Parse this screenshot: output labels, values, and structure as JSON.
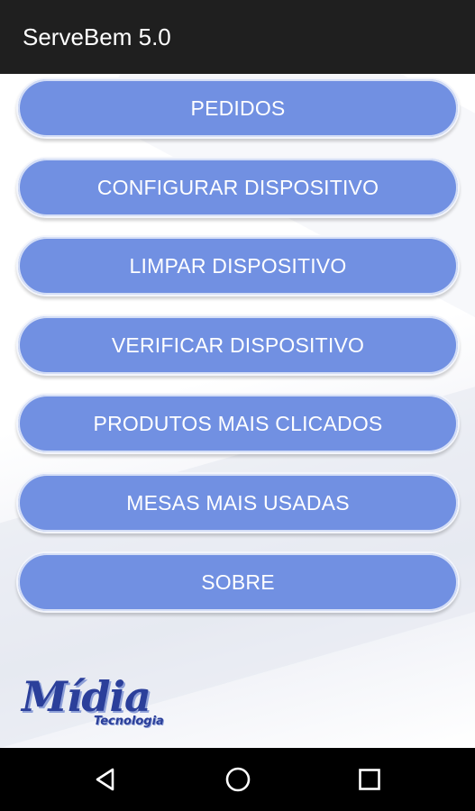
{
  "app_bar": {
    "title": "ServeBem 5.0"
  },
  "menu": {
    "items": [
      {
        "label": "PEDIDOS"
      },
      {
        "label": "CONFIGURAR DISPOSITIVO"
      },
      {
        "label": "LIMPAR DISPOSITIVO"
      },
      {
        "label": "VERIFICAR DISPOSITIVO"
      },
      {
        "label": "PRODUTOS MAIS CLICADOS"
      },
      {
        "label": "MESAS MAIS USADAS"
      },
      {
        "label": "SOBRE"
      }
    ]
  },
  "logo": {
    "main": "Mídia",
    "sub": "Tecnologia"
  },
  "colors": {
    "app_bar": "#1f1f1f",
    "button": "#7190e2",
    "logo": "#2b3f9a",
    "nav_bar": "#000000"
  },
  "nav": {
    "icons": [
      "back-icon",
      "home-icon",
      "recents-icon"
    ]
  }
}
